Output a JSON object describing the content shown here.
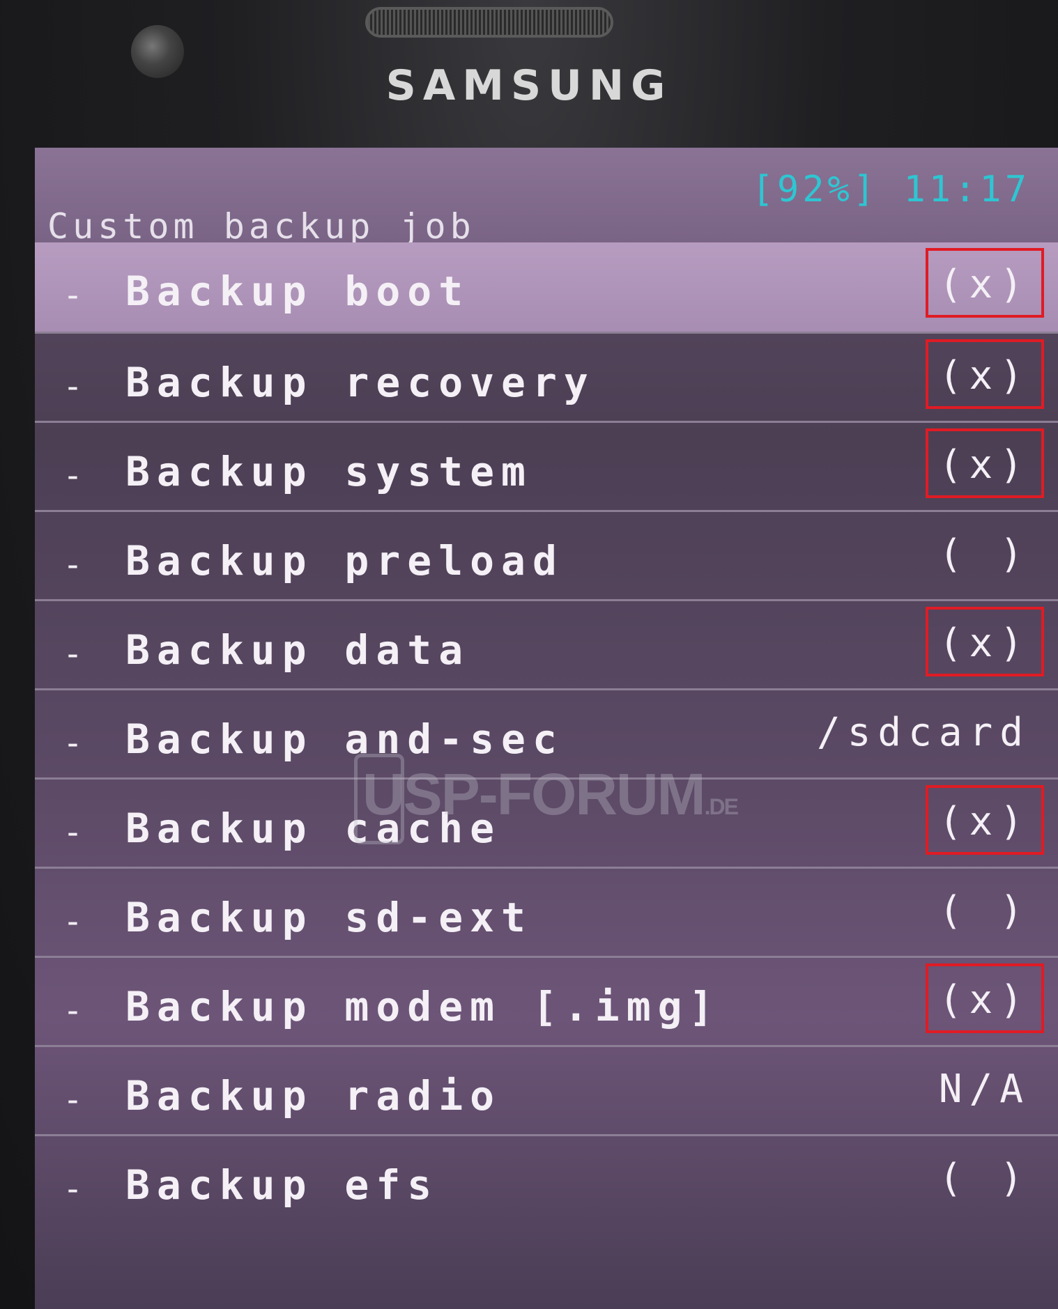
{
  "device": {
    "brand": "SAMSUNG"
  },
  "header": {
    "title": "Custom backup job",
    "status": "[92%] 11:17"
  },
  "items": [
    {
      "label": "Backup boot",
      "value": "(x)",
      "selected": true,
      "marked": true
    },
    {
      "label": "Backup recovery",
      "value": "(x)",
      "selected": false,
      "marked": true
    },
    {
      "label": "Backup system",
      "value": "(x)",
      "selected": false,
      "marked": true
    },
    {
      "label": "Backup preload",
      "value": "( )",
      "selected": false,
      "marked": false
    },
    {
      "label": "Backup data",
      "value": "(x)",
      "selected": false,
      "marked": true
    },
    {
      "label": "Backup and-sec",
      "value": "/sdcard",
      "selected": false,
      "marked": false
    },
    {
      "label": "Backup cache",
      "value": "(x)",
      "selected": false,
      "marked": true
    },
    {
      "label": "Backup sd-ext",
      "value": "( )",
      "selected": false,
      "marked": false
    },
    {
      "label": "Backup modem [.img]",
      "value": "(x)",
      "selected": false,
      "marked": true
    },
    {
      "label": "Backup radio",
      "value": "N/A",
      "selected": false,
      "marked": false
    },
    {
      "label": "Backup efs",
      "value": "( )",
      "selected": false,
      "marked": false
    }
  ],
  "row_dash": "-",
  "watermark": {
    "text": "USP-FORUM",
    "suffix": ".DE"
  },
  "colors": {
    "highlight": "#e01b24",
    "status": "#2ec6d2",
    "selected_row": "#b79cc0"
  }
}
